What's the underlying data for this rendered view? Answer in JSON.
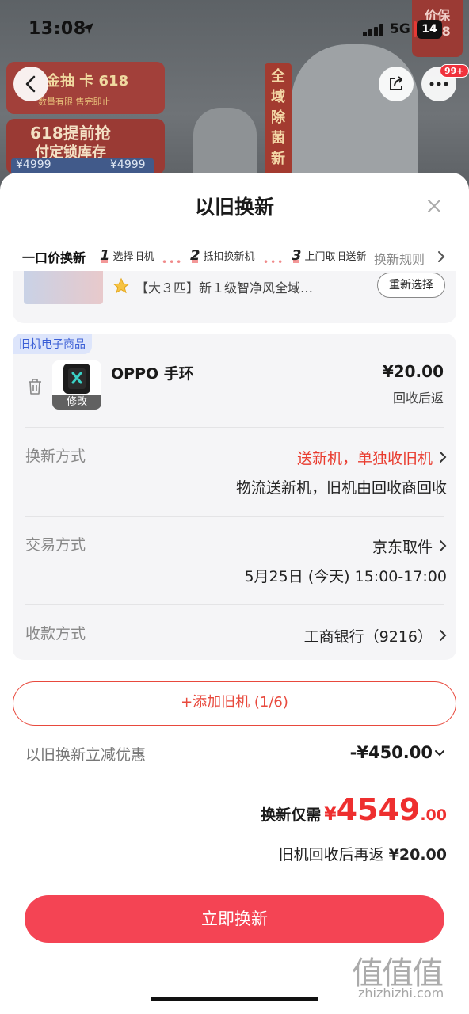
{
  "status_bar": {
    "time": "13:08",
    "network": "5G",
    "battery": "14"
  },
  "background": {
    "promo_title": "金抽 卡 618",
    "promo_sub": "数量有限 售完即止",
    "promo2_line1": "618提前抢",
    "promo2_line2": "付定锁库存",
    "price_left": "¥4999",
    "price_right": "¥4999",
    "vertical_tag": "全域除菌 新",
    "corner_tag": "价保 618"
  },
  "header_badge": "99+",
  "sheet": {
    "title": "以旧换新",
    "steps": {
      "main": "一口价换新",
      "items": [
        {
          "num": "1",
          "label": "选择旧机"
        },
        {
          "num": "2",
          "label": "抵扣换新机"
        },
        {
          "num": "3",
          "label": "上门取旧送新"
        }
      ],
      "rules": "换新规则"
    },
    "new_product": {
      "name": "【大３匹】新１级智净风全域…",
      "reselect": "重新选择"
    },
    "old_item": {
      "tag": "旧机电子商品",
      "name": "OPPO 手环",
      "edit": "修改",
      "price": "¥20.00",
      "price_note": "回收后返",
      "rows": {
        "exchange_method": {
          "label": "换新方式",
          "value": "送新机，单独收旧机",
          "sub": "物流送新机，旧机由回收商回收"
        },
        "trade_method": {
          "label": "交易方式",
          "value": "京东取件",
          "sub": "5月25日 (今天) 15:00-17:00"
        },
        "payment_method": {
          "label": "收款方式",
          "value": "工商银行（9216）"
        }
      }
    },
    "add_button": "+添加旧机 (1/6)",
    "discount": {
      "label": "以旧换新立减优惠",
      "value": "-¥450.00"
    },
    "total": {
      "label": "换新仅需",
      "currency": "¥",
      "integer": "4549",
      "decimal": ".00"
    },
    "refund": {
      "label": "旧机回收后再返",
      "amount": "¥20.00"
    },
    "cta": "立即换新"
  },
  "watermark": {
    "glyphs": "值值值",
    "site": "zhizhizhi.com"
  },
  "colors": {
    "accent_red": "#f44454",
    "price_red": "#ee2f2f",
    "tag_blue": "#3a5ed6"
  }
}
